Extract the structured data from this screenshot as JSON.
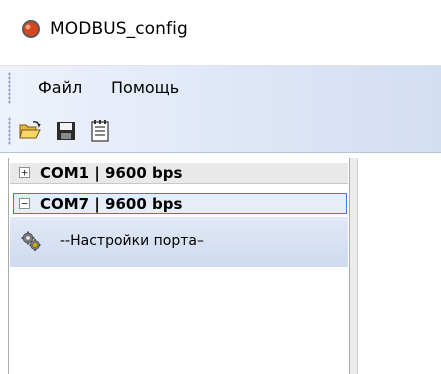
{
  "window": {
    "title": "MODBUS_config"
  },
  "menubar": {
    "items": [
      "Файл",
      "Помощь"
    ]
  },
  "toolbar": {
    "buttons": [
      "open-folder-icon",
      "save-icon",
      "notepad-icon"
    ]
  },
  "tree": {
    "nodes": [
      {
        "expander": "+",
        "label": "COM1 | 9600 bps",
        "expanded": false,
        "selected": false
      },
      {
        "expander": "−",
        "label": "COM7 | 9600 bps",
        "expanded": true,
        "selected": true,
        "children": [
          {
            "label": "--Настройки порта–",
            "icon": "gears-icon"
          }
        ]
      }
    ]
  },
  "colors": {
    "accent": "#3c7fd8",
    "toolbar_bg": "#dde5f6",
    "child_bg": "#d6e0f3"
  }
}
